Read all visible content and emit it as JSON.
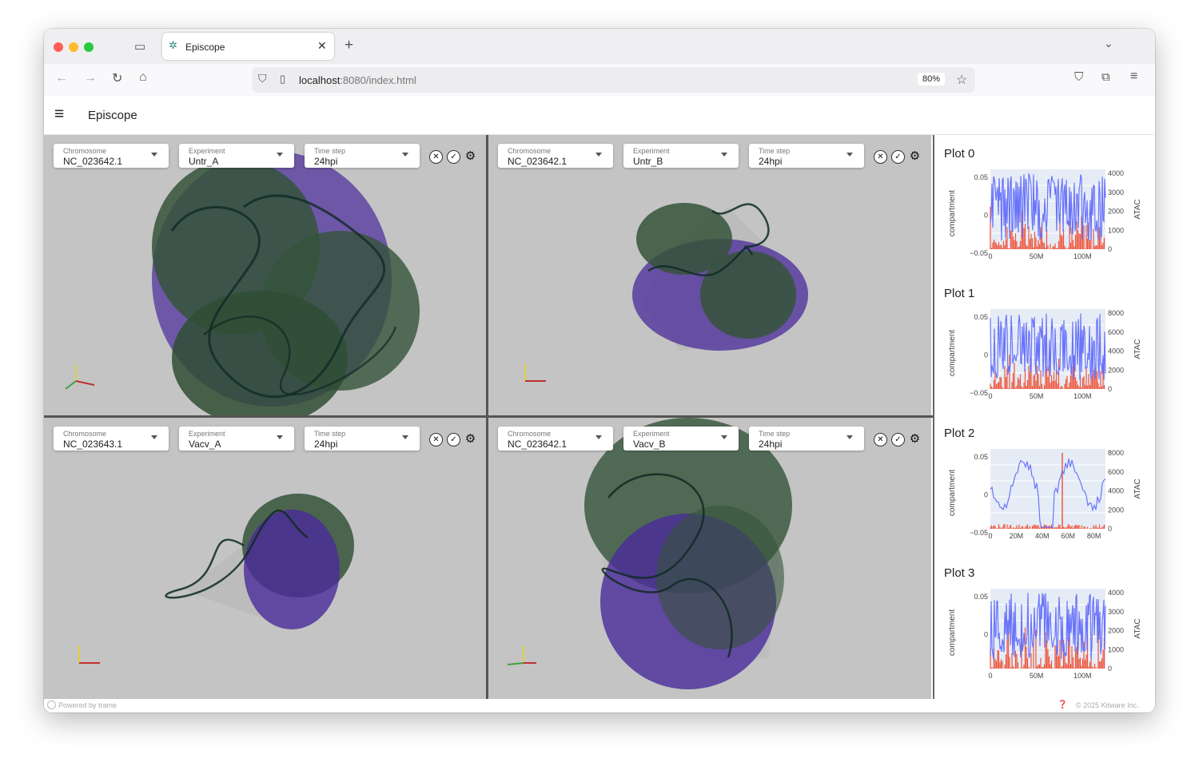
{
  "browser": {
    "tab_title": "Episcope",
    "url_host": "localhost",
    "url_rest": ":8080/index.html",
    "zoom": "80%"
  },
  "app": {
    "title": "Episcope"
  },
  "views": [
    {
      "chromosome_label": "Chromosome",
      "chromosome": "NC_023642.1",
      "experiment_label": "Experiment",
      "experiment": "Untr_A",
      "timestep_label": "Time step",
      "timestep": "24hpi"
    },
    {
      "chromosome_label": "Chromosome",
      "chromosome": "NC_023642.1",
      "experiment_label": "Experiment",
      "experiment": "Untr_B",
      "timestep_label": "Time step",
      "timestep": "24hpi"
    },
    {
      "chromosome_label": "Chromosome",
      "chromosome": "NC_023643.1",
      "experiment_label": "Experiment",
      "experiment": "Vacv_A",
      "timestep_label": "Time step",
      "timestep": "24hpi"
    },
    {
      "chromosome_label": "Chromosome",
      "chromosome": "NC_023642.1",
      "experiment_label": "Experiment",
      "experiment": "Vacv_B",
      "timestep_label": "Time step",
      "timestep": "24hpi"
    }
  ],
  "colors": {
    "compartment": "#636efa",
    "atac": "#ef553b",
    "plot_bg": "#e5ecf6",
    "viewport_bg": "#c4c4c4"
  },
  "plots": [
    {
      "title": "Plot 0",
      "ylabel": "compartment",
      "y2label": "ATAC",
      "yticks": [
        "0.05",
        "0",
        "−0.05"
      ],
      "y2ticks": [
        "4000",
        "3000",
        "2000",
        "1000",
        "0"
      ],
      "xticks": [
        "0",
        "50M",
        "100M"
      ]
    },
    {
      "title": "Plot 1",
      "ylabel": "compartment",
      "y2label": "ATAC",
      "yticks": [
        "0.05",
        "0",
        "−0.05"
      ],
      "y2ticks": [
        "8000",
        "6000",
        "4000",
        "2000",
        "0"
      ],
      "xticks": [
        "0",
        "50M",
        "100M"
      ]
    },
    {
      "title": "Plot 2",
      "ylabel": "compartment",
      "y2label": "ATAC",
      "yticks": [
        "0.05",
        "0",
        "−0.05"
      ],
      "y2ticks": [
        "8000",
        "6000",
        "4000",
        "2000",
        "0"
      ],
      "xticks": [
        "0",
        "20M",
        "40M",
        "60M",
        "80M"
      ]
    },
    {
      "title": "Plot 3",
      "ylabel": "compartment",
      "y2label": "ATAC",
      "yticks": [
        "0.05",
        "0"
      ],
      "y2ticks": [
        "4000",
        "3000",
        "2000",
        "1000",
        "0"
      ],
      "xticks": [
        "0",
        "50M",
        "100M"
      ]
    }
  ],
  "footer": {
    "left": "Powered by trame",
    "right": "© 2025 Kitware Inc."
  }
}
